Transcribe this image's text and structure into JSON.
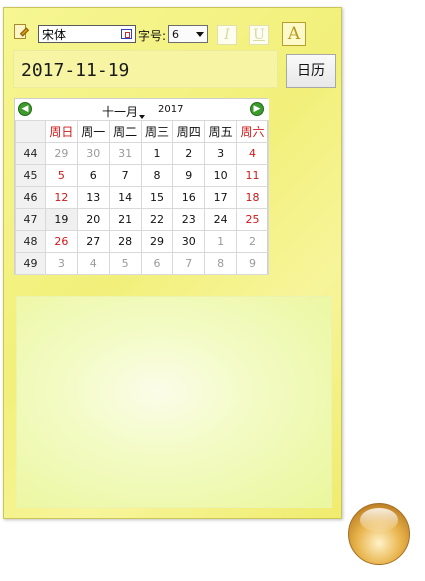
{
  "toolbar": {
    "font_name": "宋体",
    "size_label": "字号:",
    "size_value": "6",
    "italic_label": "I",
    "underline_label": "U",
    "color_label": "A"
  },
  "date_display": "2017-11-19",
  "calendar_button": "日历",
  "calendar": {
    "month": "十一月",
    "year": "2017",
    "weekdays": [
      "周日",
      "周一",
      "周二",
      "周三",
      "周四",
      "周五",
      "周六"
    ],
    "weeks": [
      {
        "no": "44",
        "days": [
          "29",
          "30",
          "31",
          "1",
          "2",
          "3",
          "4"
        ]
      },
      {
        "no": "45",
        "days": [
          "5",
          "6",
          "7",
          "8",
          "9",
          "10",
          "11"
        ]
      },
      {
        "no": "46",
        "days": [
          "12",
          "13",
          "14",
          "15",
          "16",
          "17",
          "18"
        ]
      },
      {
        "no": "47",
        "days": [
          "19",
          "20",
          "21",
          "22",
          "23",
          "24",
          "25"
        ]
      },
      {
        "no": "48",
        "days": [
          "26",
          "27",
          "28",
          "29",
          "30",
          "1",
          "2"
        ]
      },
      {
        "no": "49",
        "days": [
          "3",
          "4",
          "5",
          "6",
          "7",
          "8",
          "9"
        ]
      }
    ]
  },
  "colors": {
    "note_background": "#f4f38a",
    "weekend_red": "#d01818",
    "nav_green": "#3d9a2c"
  }
}
